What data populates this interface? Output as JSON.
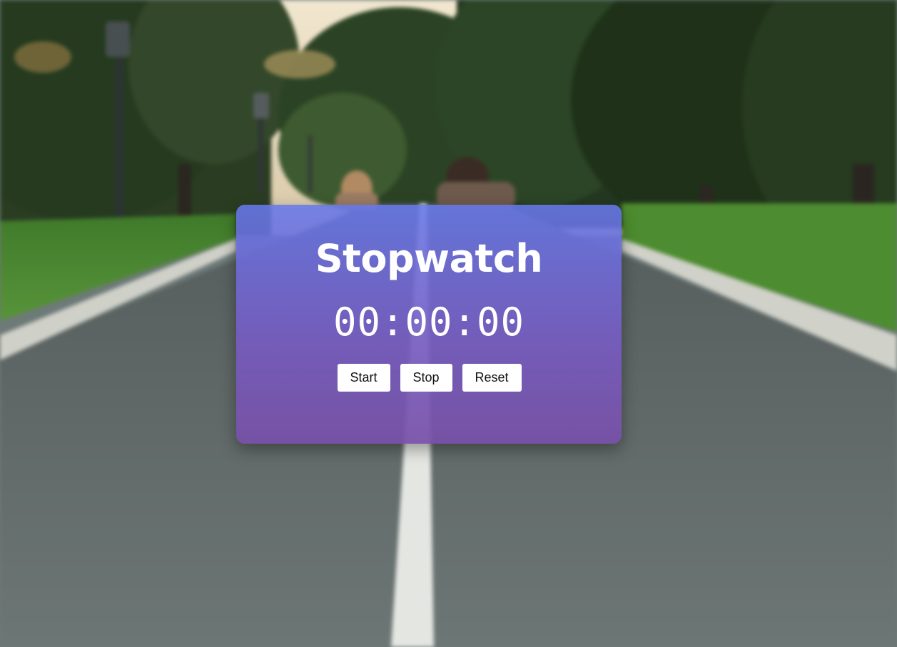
{
  "background": {
    "description_icon": "park-running-road-photo",
    "sky_color": "#e9dcc4",
    "tree_color": "#22351f",
    "grass_color": "#4f8a32",
    "road_color": "#5e6866",
    "lane_line_color": "#e6e8e4"
  },
  "stopwatch": {
    "title": "Stopwatch",
    "time": "00:00:00",
    "buttons": {
      "start_label": "Start",
      "stop_label": "Stop",
      "reset_label": "Reset"
    },
    "card_gradient": [
      "#6678ea",
      "#7850a8"
    ]
  }
}
